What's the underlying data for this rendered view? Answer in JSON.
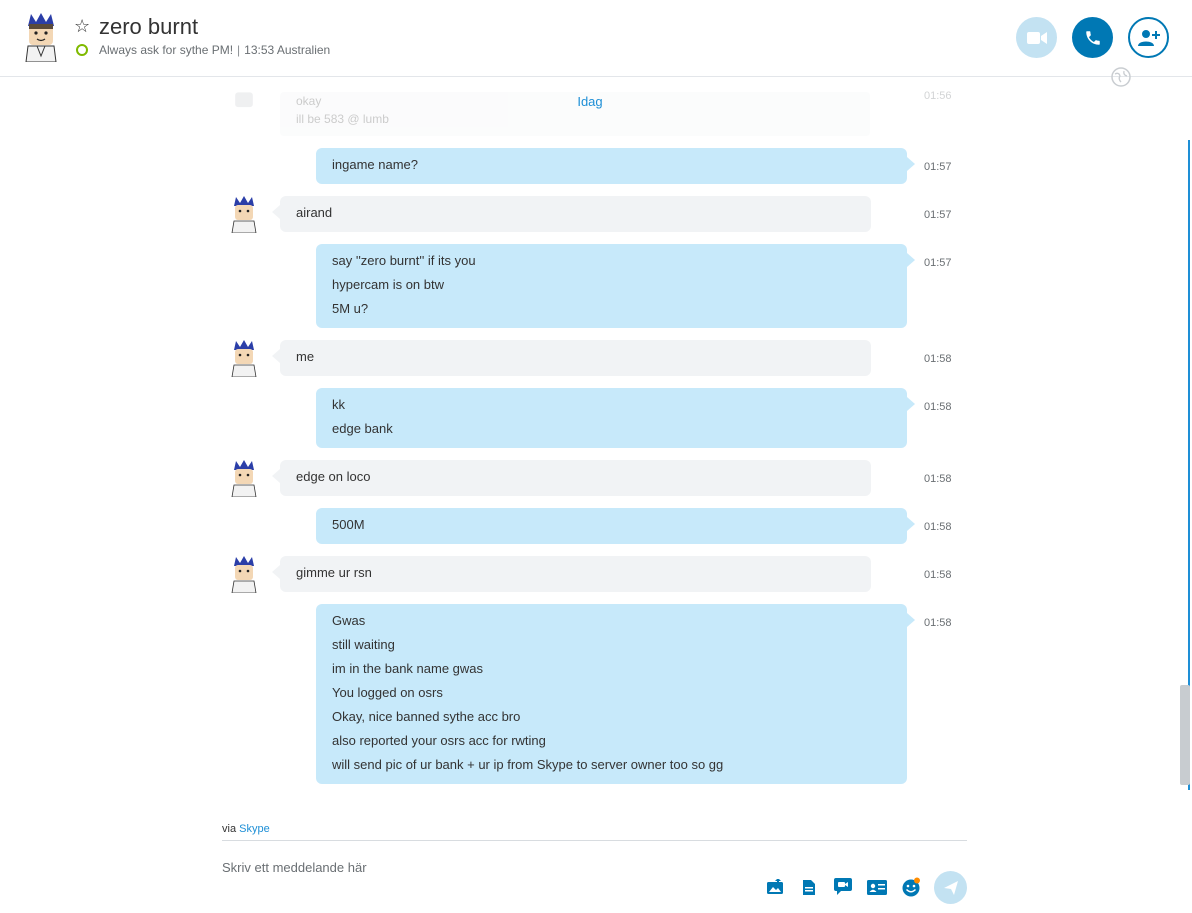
{
  "header": {
    "contact_name": "zero burnt",
    "mood": "Always ask for sythe PM!",
    "separator": "|",
    "local_time": "13:53 Australien"
  },
  "chat": {
    "day_label": "Idag",
    "faded_lines": [
      "okay",
      "ill be 583 @ lumb"
    ],
    "faded_time": "01:56",
    "messages": [
      {
        "dir": "out",
        "time": "01:57",
        "lines": [
          "ingame name?"
        ]
      },
      {
        "dir": "in",
        "time": "01:57",
        "lines": [
          "airand"
        ]
      },
      {
        "dir": "out",
        "time": "01:57",
        "lines": [
          "say ''zero burnt'' if its you",
          "hypercam is on btw",
          "5M u?"
        ]
      },
      {
        "dir": "in",
        "time": "01:58",
        "lines": [
          "me"
        ]
      },
      {
        "dir": "out",
        "time": "01:58",
        "lines": [
          "kk",
          "edge bank"
        ]
      },
      {
        "dir": "in",
        "time": "01:58",
        "lines": [
          "edge on loco"
        ]
      },
      {
        "dir": "out",
        "time": "01:58",
        "lines": [
          "500M"
        ]
      },
      {
        "dir": "in",
        "time": "01:58",
        "lines": [
          "gimme ur rsn"
        ]
      },
      {
        "dir": "out",
        "time": "01:58",
        "lines": [
          "Gwas",
          "still waiting",
          "im in the bank name gwas",
          "You logged on osrs",
          "Okay, nice banned sythe acc bro",
          "also reported your osrs acc for rwting",
          "will send pic of ur bank + ur ip from Skype to server owner too so gg"
        ]
      }
    ]
  },
  "composer": {
    "via_prefix": "via",
    "via_link": "Skype",
    "placeholder": "Skriv ett meddelande här"
  },
  "colors": {
    "accent": "#0078b4",
    "outgoing_bubble": "#c7e9fa",
    "incoming_bubble": "#f1f3f5",
    "presence": "#7fba00"
  }
}
